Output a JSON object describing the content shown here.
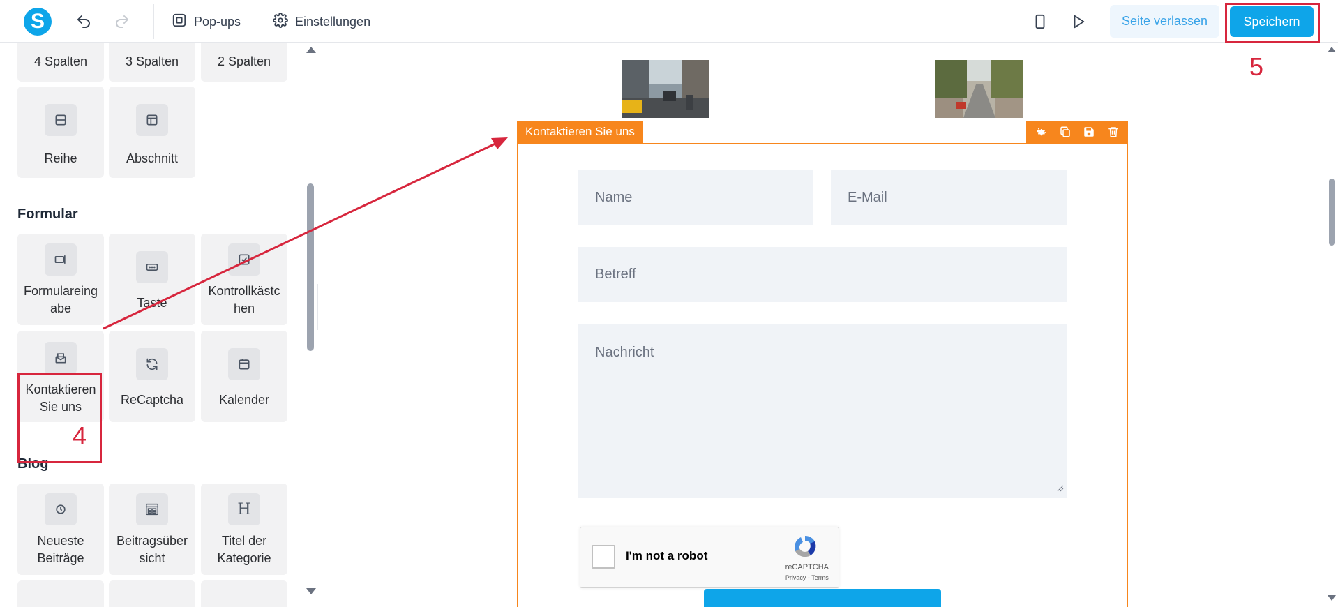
{
  "toolbar": {
    "logo_letter": "S",
    "popups_label": "Pop-ups",
    "settings_label": "Einstellungen",
    "leave_label": "Seite verlassen",
    "save_label": "Speichern"
  },
  "sidebar": {
    "layout_tiles": [
      "4 Spalten",
      "3 Spalten",
      "2 Spalten",
      "Reihe",
      "Abschnitt"
    ],
    "form_section_title": "Formular",
    "form_tiles": [
      "Formulareing abe",
      "Taste",
      "Kontrollkästc hen",
      "Kontaktieren Sie uns",
      "ReCaptcha",
      "Kalender"
    ],
    "blog_section_title": "Blog",
    "blog_tiles": [
      "Neueste Beiträge",
      "Beitragsüber sicht",
      "Titel der Kategorie"
    ]
  },
  "annotations": {
    "step4": "4",
    "step5": "5",
    "color": "#d7263d"
  },
  "canvas": {
    "block_label": "Kontaktieren Sie uns",
    "fields": {
      "name": "Name",
      "email": "E-Mail",
      "subject": "Betreff",
      "message": "Nachricht"
    },
    "recaptcha": {
      "label": "I'm not a robot",
      "brand": "reCAPTCHA",
      "links": "Privacy - Terms"
    }
  },
  "colors": {
    "accent": "#0ea5e9",
    "block_orange": "#f7861d",
    "highlight_red": "#d7263d"
  }
}
